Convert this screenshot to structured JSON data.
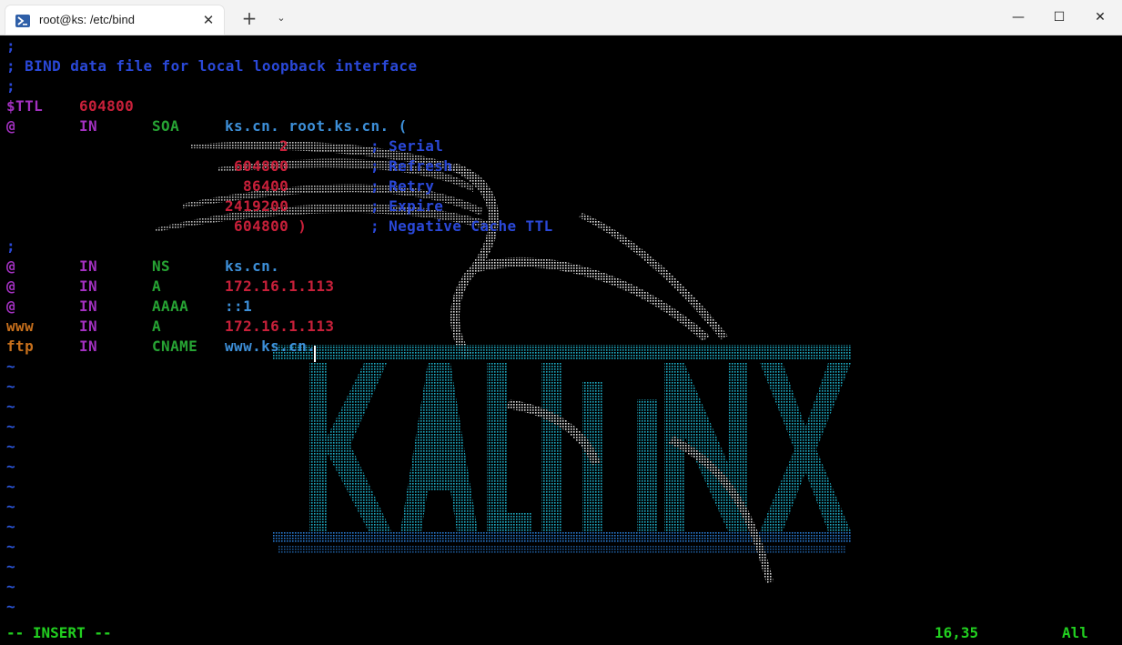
{
  "window": {
    "tab_title": "root@ks: /etc/bind",
    "tab_close": "✕",
    "new_tab": "+",
    "tab_dropdown": "⌄",
    "minimize": "—",
    "maximize": "☐",
    "close": "✕"
  },
  "editor": {
    "comment1": ";",
    "comment2": "; BIND data file for local loopback interface",
    "comment3": ";",
    "ttl_key": "$TTL",
    "ttl_val": "604800",
    "soa": {
      "name": "@",
      "class": "IN",
      "type": "SOA",
      "data": "ks.cn. root.ks.cn. ("
    },
    "serial": {
      "value": "2",
      "comment": "; Serial"
    },
    "refresh": {
      "value": "604800",
      "comment": "; Refresh"
    },
    "retry": {
      "value": "86400",
      "comment": "; Retry"
    },
    "expire": {
      "value": "2419200",
      "comment": "; Expire"
    },
    "negttl": {
      "value": "604800 )",
      "comment": "; Negative Cache TTL"
    },
    "comment4": ";",
    "records": [
      {
        "name": "@",
        "class": "IN",
        "type": "NS",
        "data": "ks.cn."
      },
      {
        "name": "@",
        "class": "IN",
        "type": "A",
        "data": "172.16.1.113"
      },
      {
        "name": "@",
        "class": "IN",
        "type": "AAAA",
        "data": "::1"
      },
      {
        "name": "www",
        "class": "IN",
        "type": "A",
        "data": "172.16.1.113"
      },
      {
        "name": "ftp",
        "class": "IN",
        "type": "CNAME",
        "data": "www.ks.cn."
      }
    ],
    "tilde": "~"
  },
  "status": {
    "mode": "-- INSERT --",
    "position": "16,35",
    "scroll": "All"
  },
  "colors": {
    "comment": "#2a48d8",
    "keyword": "#a230c0",
    "number": "#c8203a",
    "type": "#27a434",
    "data": "#3d8fd8",
    "name": "#c8701c",
    "status": "#22d020",
    "background_art_text": "#1aa8c8"
  }
}
